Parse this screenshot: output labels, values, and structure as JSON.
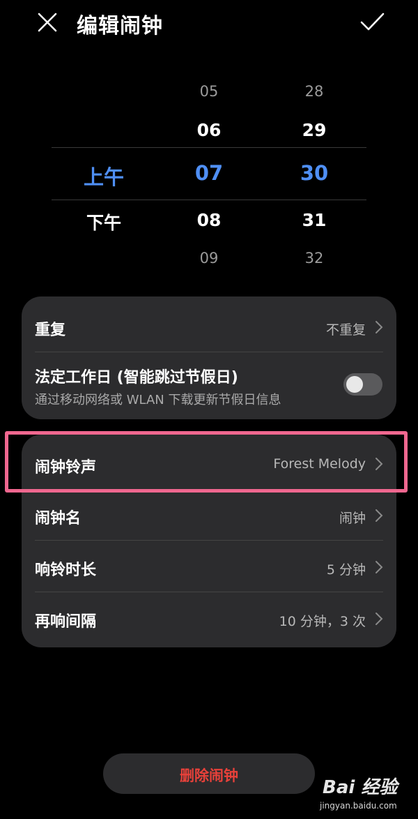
{
  "header": {
    "title": "编辑闹钟",
    "close_icon": "close-icon",
    "confirm_icon": "check-icon"
  },
  "time_picker": {
    "ampm": {
      "options": [
        "上午",
        "下午"
      ],
      "selected": "上午"
    },
    "hours": {
      "values": [
        "05",
        "06",
        "07",
        "08",
        "09"
      ],
      "selected": "07"
    },
    "minutes": {
      "values": [
        "28",
        "29",
        "30",
        "31",
        "32"
      ],
      "selected": "30"
    },
    "selected_color": "#4f8ff5"
  },
  "settings_card1": {
    "repeat": {
      "label": "重复",
      "value": "不重复"
    },
    "workday": {
      "label": "法定工作日 (智能跳过节假日)",
      "description": "通过移动网络或 WLAN 下载更新节假日信息",
      "enabled": false
    }
  },
  "settings_card2": {
    "ringtone": {
      "label": "闹钟铃声",
      "value": "Forest Melody"
    },
    "name": {
      "label": "闹钟名",
      "value": "闹钟"
    },
    "duration": {
      "label": "响铃时长",
      "value": "5 分钟"
    },
    "snooze": {
      "label": "再响间隔",
      "value": "10 分钟，3 次"
    }
  },
  "delete_button": {
    "label": "删除闹钟",
    "color": "#e8413a"
  },
  "highlight_color": "#f0678f",
  "watermark": {
    "text": "Bai 经验",
    "url": "jingyan.baidu.com"
  }
}
